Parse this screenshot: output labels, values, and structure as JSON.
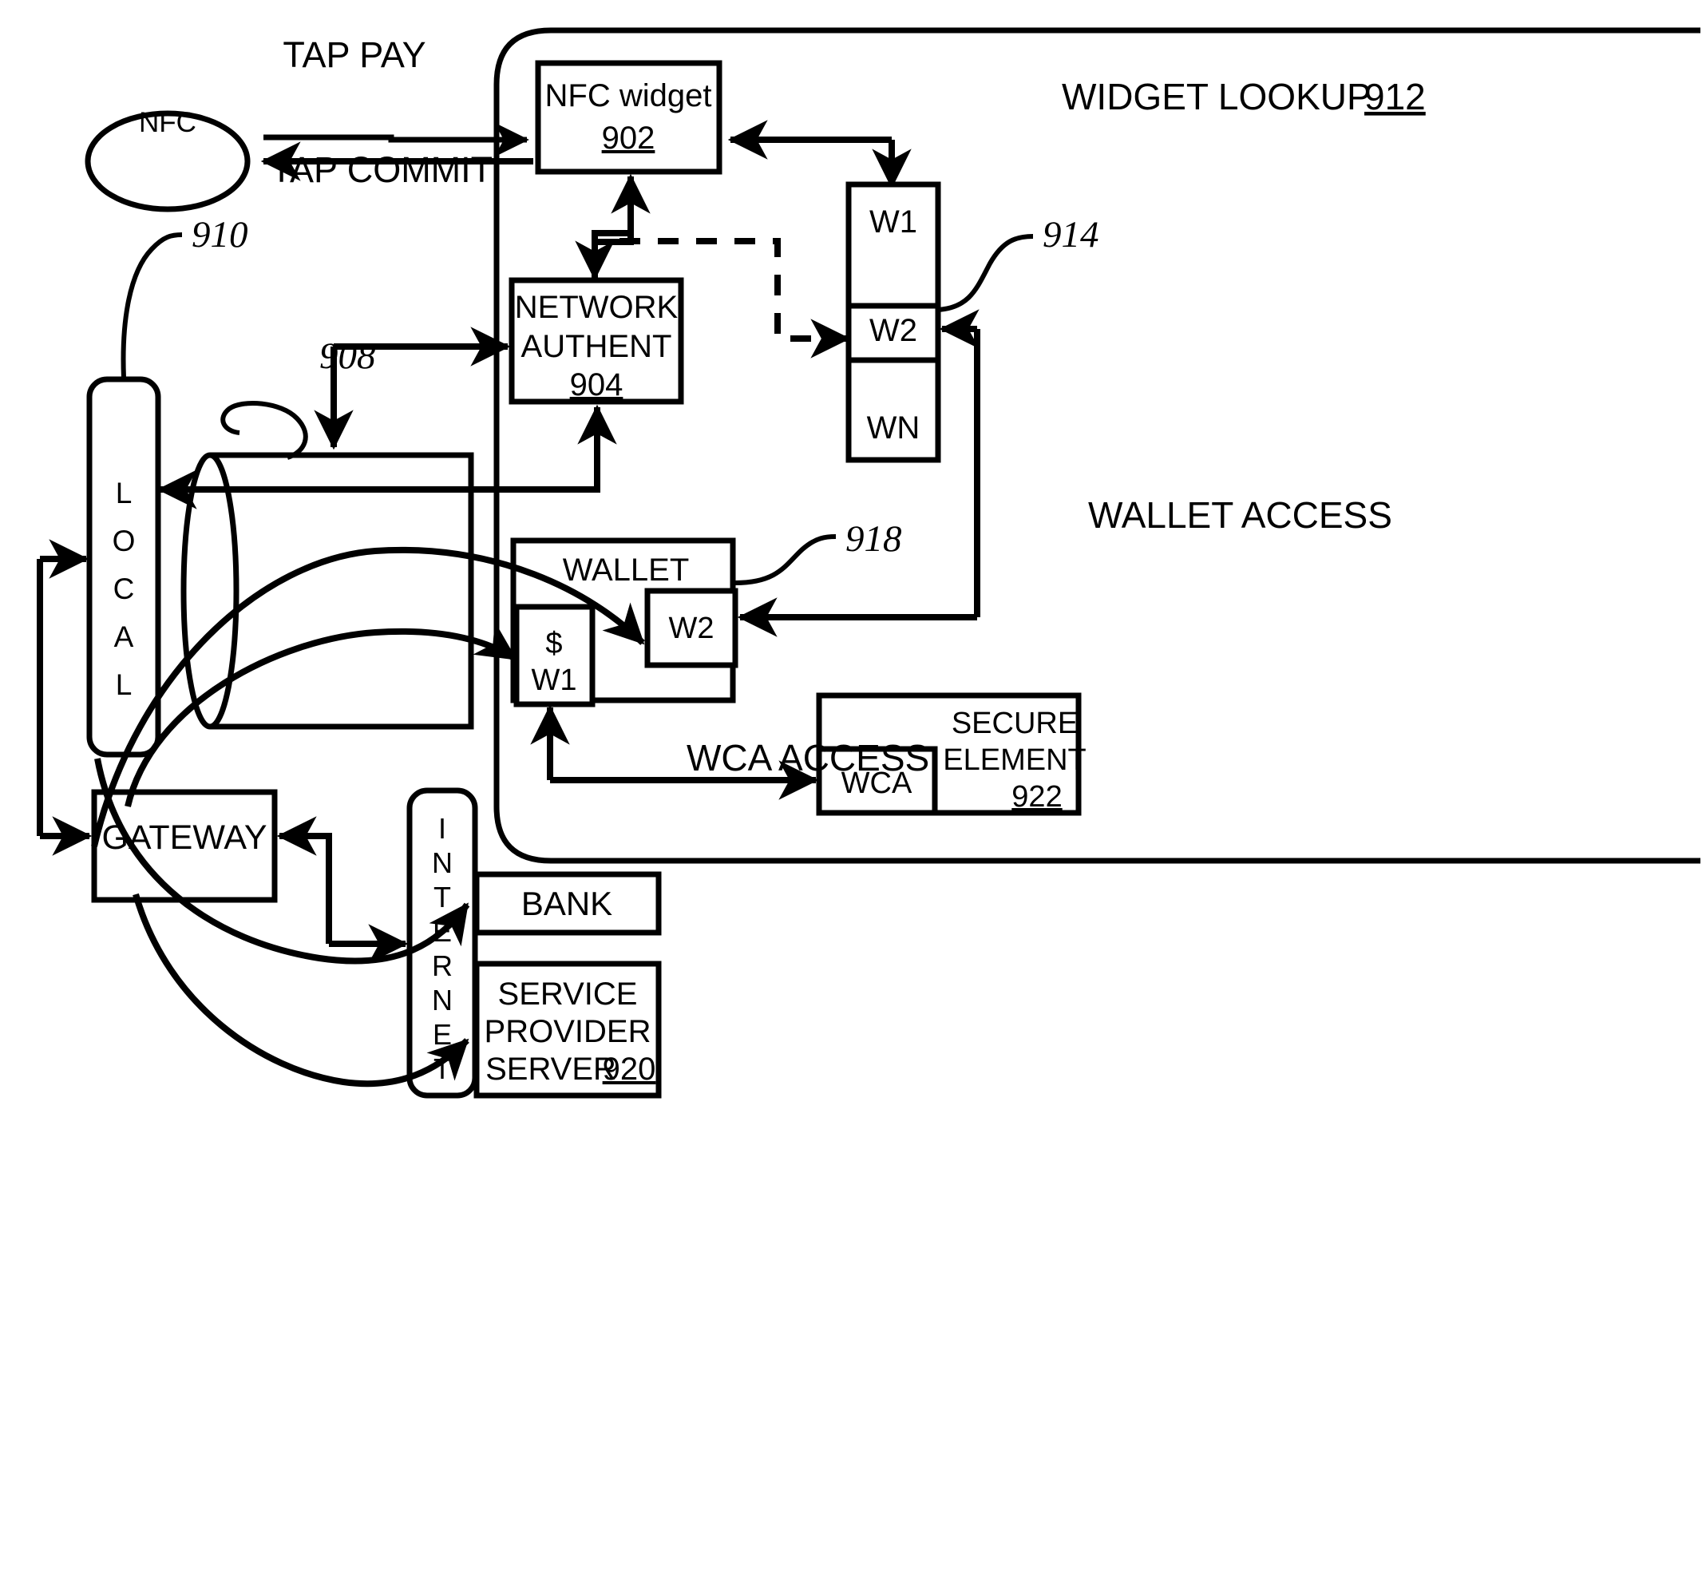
{
  "figure": {
    "type": "patent-block-diagram",
    "background": "#ffffff",
    "line_color": "#000000"
  },
  "nodes": {
    "nfc_ellipse": {
      "label": "NFC"
    },
    "nfc_widget": {
      "label": "NFC widget",
      "ref": "902"
    },
    "network_authent": {
      "line1": "NETWORK",
      "line2": "AUTHENT",
      "ref": "904"
    },
    "widget_list": {
      "items": [
        "W1",
        "W2",
        "WN"
      ]
    },
    "wallet": {
      "label": "WALLET",
      "item_w1_currency": "$",
      "item_w1": "W1",
      "item_w2": "W2"
    },
    "secure_element": {
      "wca": "WCA",
      "line1": "SECURE",
      "line2": "ELEMENT",
      "ref": "922"
    },
    "local": {
      "label": "LOCAL",
      "letters": [
        "L",
        "O",
        "C",
        "A",
        "L"
      ]
    },
    "database": {
      "label": ""
    },
    "gateway": {
      "label": "GATEWAY"
    },
    "internet": {
      "label": "INTERNET",
      "letters": [
        "I",
        "N",
        "T",
        "E",
        "R",
        "N",
        "E",
        "T"
      ]
    },
    "bank": {
      "label": "BANK"
    },
    "service_provider_server": {
      "line1": "SERVICE",
      "line2": "PROVIDER",
      "line3": "SERVER",
      "ref": "920"
    }
  },
  "edge_labels": {
    "tap_pay": "TAP PAY",
    "tap_commit": "TAP COMMIT",
    "widget_lookup": "WIDGET LOOKUP",
    "widget_lookup_ref": "912",
    "wallet_access": "WALLET ACCESS",
    "wca_access": "WCA ACCESS"
  },
  "reference_numerals": {
    "n908": "908",
    "n910": "910",
    "n914": "914",
    "n918": "918"
  }
}
